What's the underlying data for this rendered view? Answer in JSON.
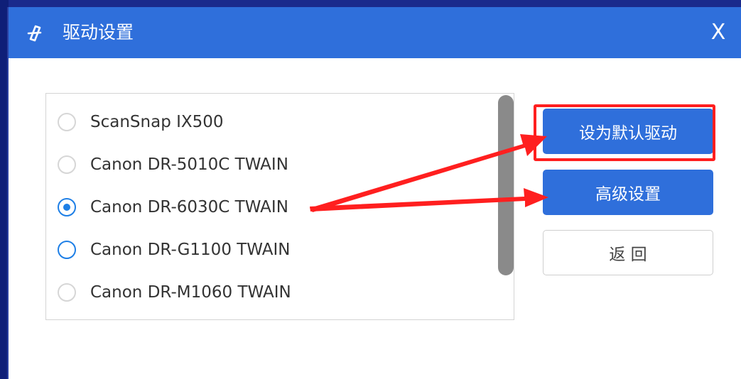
{
  "window": {
    "title": "驱动设置",
    "close_glyph": "X",
    "app_icon": "scanner-logo-icon"
  },
  "drivers": {
    "items": [
      {
        "label": "ScanSnap IX500",
        "state": "unselected"
      },
      {
        "label": "Canon DR-5010C TWAIN",
        "state": "unselected"
      },
      {
        "label": "Canon DR-6030C TWAIN",
        "state": "selected"
      },
      {
        "label": "Canon DR-G1100 TWAIN",
        "state": "hover"
      },
      {
        "label": "Canon DR-M1060 TWAIN",
        "state": "unselected"
      }
    ]
  },
  "actions": {
    "set_default_label": "设为默认驱动",
    "advanced_label": "高级设置",
    "back_label": "返 回"
  },
  "annotations": {
    "highlight_color": "#ff1f1f",
    "arrow_color": "#ff1f1f"
  },
  "colors": {
    "accent": "#2f6fdb",
    "radio_selected": "#1e7fe6"
  }
}
